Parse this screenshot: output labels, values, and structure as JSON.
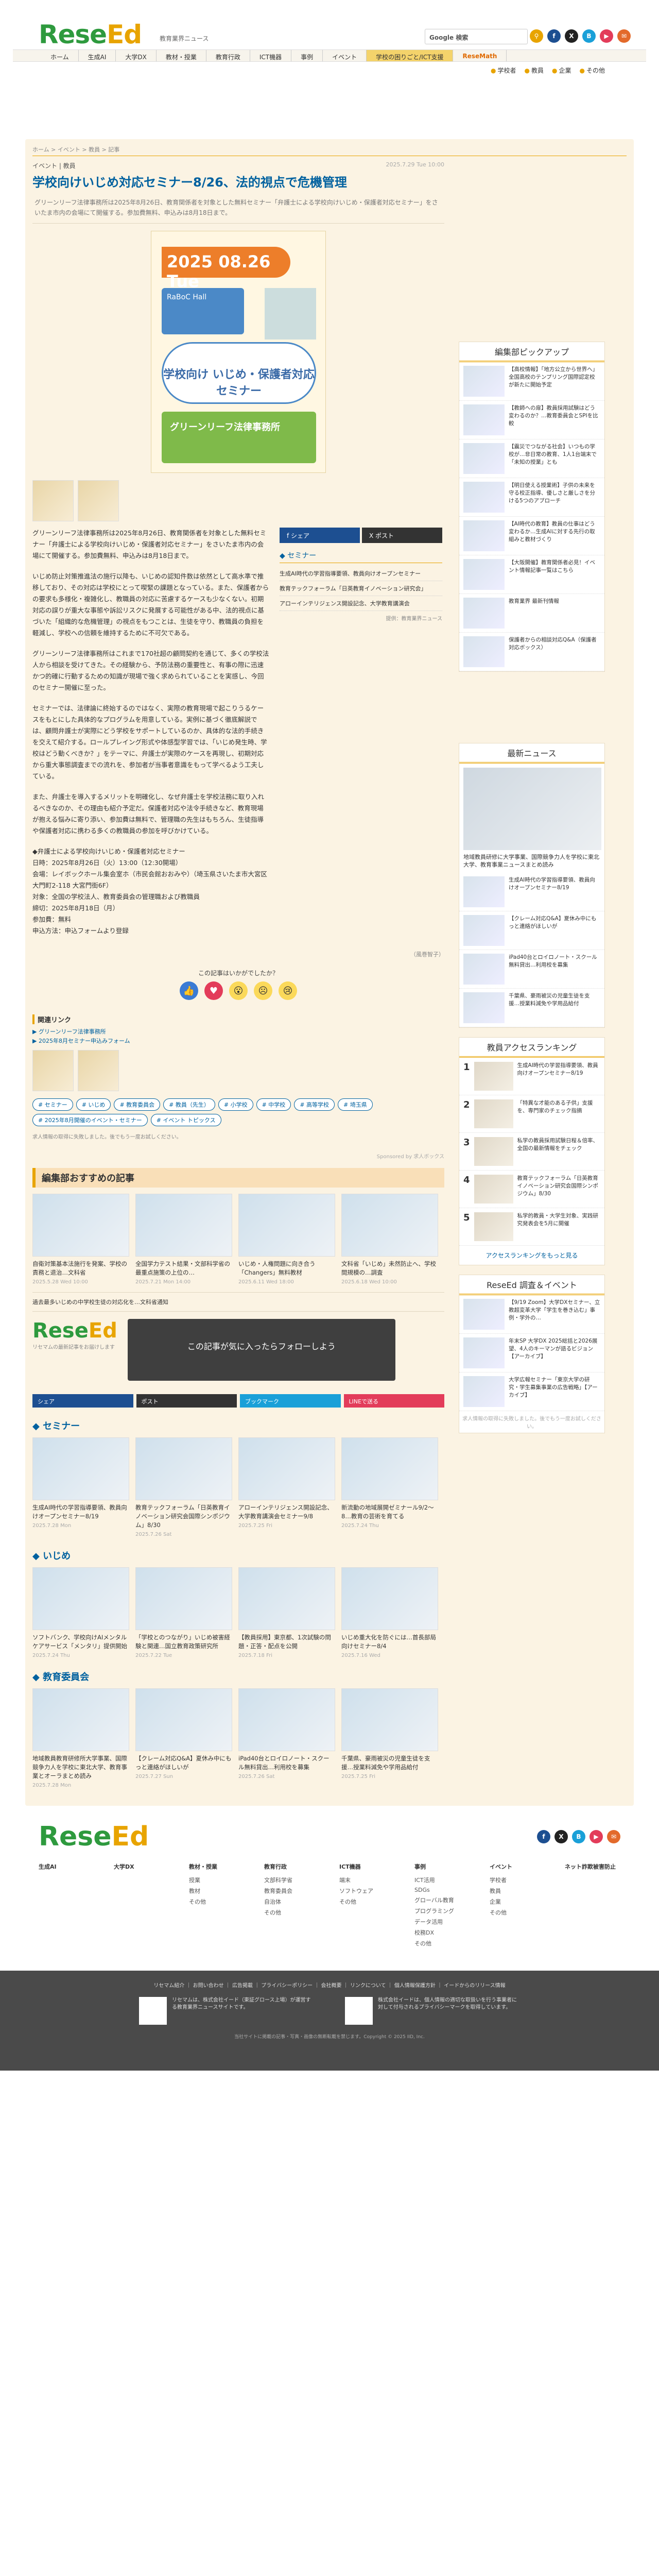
{
  "header": {
    "site_sub": "教育業界ニュース",
    "search_label": "Google 検索",
    "nav": [
      "ホーム",
      "生成AI",
      "大学DX",
      "教材・授業",
      "教育行政",
      "ICT機器",
      "事例",
      "イベント",
      "学校の困りごと/ICT支援",
      "ReseMath"
    ],
    "subnav": [
      "学校者",
      "教員",
      "企業",
      "その他"
    ]
  },
  "breadcrumb": "ホーム > イベント > 教員 > 記事",
  "article": {
    "category": "イベント | 教員",
    "date": "2025.7.29 Tue 10:00",
    "title": "学校向けいじめ対応セミナー8/26、法的視点で危機管理",
    "lead": "グリーンリーフ法律事務所は2025年8月26日、教育関係者を対象とした無料セミナー「弁護士による学校向けいじめ・保護者対応セミナー」をさいたま市内の会場にて開催する。参加費無料、申込みは8月18日まで。",
    "hero": {
      "date": "2025 08.26 Tue",
      "venue": "RaBoC Hall",
      "main": "学校向け いじめ・保護者対応セミナー",
      "org": "グリーンリーフ法律事務所"
    },
    "paragraphs": [
      "グリーンリーフ法律事務所は2025年8月26日、教育関係者を対象とした無料セミナー「弁護士による学校向けいじめ・保護者対応セミナー」をさいたま市内の会場にて開催する。参加費無料、申込みは8月18日まで。",
      "いじめ防止対策推進法の施行以降も、いじめの認知件数は依然として高水準で推移しており、その対応は学校にとって喫緊の課題となっている。また、保護者からの要求も多様化・複雑化し、教職員の対応に苦慮するケースも少なくない。初期対応の誤りが重大な事態や訴訟リスクに発展する可能性がある中、法的視点に基づいた「組織的な危機管理」の視点をもつことは、生徒を守り、教職員の負担を軽減し、学校への信頼を維持するために不可欠である。",
      "グリーンリーフ法律事務所はこれまで170社超の顧問契約を通じて、多くの学校法人から相談を受けてきた。その経験から、予防法務の重要性と、有事の際に迅速かつ的確に行動するための知識が現場で強く求められていることを実感し、今回のセミナー開催に至った。",
      "セミナーでは、法律論に終始するのではなく、実際の教育現場で起こりうるケースをもとにした具体的なプログラムを用意している。実例に基づく徹底解説では、顧問弁護士が実際にどう学校をサポートしているのか、具体的な法的手続きを交えて紹介する。ロールプレイング形式や体感型学習では、「いじめ発生時、学校はどう動くべきか？」をテーマに、弁護士が実際のケースを再現し、初期対応から重大事態調査までの流れを、参加者が当事者意識をもって学べるよう工夫している。",
      "また、弁護士を導入するメリットを明確化し、なぜ弁護士を学校法務に取り入れるべきなのか、その理由も紹介予定だ。保護者対応や法令手続きなど、教育現場が抱える悩みに寄り添い、参加費は無料で、管理職の先生はもちろん、生徒指導や保護者対応に携わる多くの教職員の参加を呼びかけている。",
      "◆弁護士による学校向けいじめ・保護者対応セミナー\n日時：2025年8月26日（火）13:00（12:30開場）\n会場：レイボックホール集会室ホ（市民会館おおみや）（埼玉県さいたま市大宮区大門町2-118 大宮門街6F）\n対象：全国の学校法人、教育委員会の管理職および教職員\n締切：2025年8月18日（月）\n参加費：無料\n申込方法：申込フォームより登録"
    ],
    "writer": "（風巻智子）",
    "reaction_q": "この記事はいかがでしたか？",
    "share_fb": "シェア",
    "share_x": "ポスト",
    "seminar_head": "セミナー",
    "seminar_list": [
      "生成AI時代の学習指導要領、教員向けオープンセミナー",
      "教育テックフォーラム「日英教育イノベーション研究会」",
      "アローインテリジェンス開設記念、大学教育講演会"
    ],
    "seminar_foot": "提供：教育業界ニュース"
  },
  "related": {
    "head": "関連リンク",
    "links": [
      "グリーンリーフ法律事務所",
      "2025年8月セミナー申込みフォーム"
    ]
  },
  "tags": [
    "セミナー",
    "いじめ",
    "教育委員会",
    "教員（先生）",
    "小学校",
    "中学校",
    "高等学校",
    "埼玉県",
    "2025年8月開催のイベント・セミナー",
    "イベント トピックス"
  ],
  "note": "求人情報の取得に失敗しました。後でもう一度お試しください。",
  "sponsored": "Sponsored by 求人ボックス",
  "recommend": {
    "head": "編集部おすすめの記事",
    "cards": [
      {
        "t": "自衛対策基本法施行を発案、学校の責務と退治…文科省",
        "d": "2025.5.28 Wed 10:00"
      },
      {
        "t": "全国学力テスト結果・文部科学省の最重点施策の上位の…",
        "d": "2025.7.21 Mon 14:00"
      },
      {
        "t": "いじめ・人権問題に向き合う「Changers」無料教材",
        "d": "2025.6.11 Wed 18:00"
      },
      {
        "t": "文科省「いじめ」未然防止へ、学校間規模の…調査",
        "d": "2025.6.18 Wed 10:00"
      }
    ],
    "wide": "過去最多いじめの中学校生徒の対応化を…文科省通知"
  },
  "follow": {
    "text": "この記事が気に入ったらフォローしよう",
    "sub": "リセマムの最新記事をお届けします",
    "shares": [
      "シェア",
      "ポスト",
      "ブックマーク",
      "LINEで送る"
    ]
  },
  "categories": [
    {
      "head": "セミナー",
      "cards": [
        {
          "t": "生成AI時代の学習指導要領、教員向けオープンセミナー8/19",
          "d": "2025.7.28 Mon"
        },
        {
          "t": "教育テックフォーラム「日英教育イノベーション研究会国際シンポジウム」8/30",
          "d": "2025.7.26 Sat"
        },
        {
          "t": "アローインテリジェンス開設記念、大学教育講演会セミナー9/8",
          "d": "2025.7.25 Fri"
        },
        {
          "t": "新流動の地域展開ゼミナール9/2～8…教育の芸術を育てる",
          "d": "2025.7.24 Thu"
        }
      ]
    },
    {
      "head": "いじめ",
      "cards": [
        {
          "t": "ソフトバンク、学校向けAIメンタルケアサービス「メンタリ」提供開始",
          "d": "2025.7.24 Thu"
        },
        {
          "t": "「学校とのつながり」いじめ被害経験と関連…国立教育政策研究所",
          "d": "2025.7.22 Tue"
        },
        {
          "t": "【教員採用】東京都、1次試験の問題・正答・配点を公開",
          "d": "2025.7.18 Fri"
        },
        {
          "t": "いじめ重大化を防ぐには…首長部局向けセミナー8/4",
          "d": "2025.7.16 Wed"
        }
      ]
    },
    {
      "head": "教育委員会",
      "cards": [
        {
          "t": "地域教員教育研修所大学事業、国際競争力人を学校に東北大学、教育事業とオーラまとめ読み",
          "d": "2025.7.28 Mon"
        },
        {
          "t": "【クレーム対応Q&A】夏休み中にもっと連絡がほしいが",
          "d": "2025.7.27 Sun"
        },
        {
          "t": "iPad40台とロイロノート・スクール無料貸出…利用校を募集",
          "d": "2025.7.26 Sat"
        },
        {
          "t": "千葉県、豪雨被災の児童生徒を支援…授業料減免や学用品給付",
          "d": "2025.7.25 Fri"
        }
      ]
    }
  ],
  "sidebar": {
    "picks_head": "編集部ピックアップ",
    "picks": [
      "【高校情報】「地方公立から世界へ」全国高校のテンプリング国際認定校が新たに開始予定",
      "【教師への扉】教員採用試験はどう変わるのか？…教育委員会とSPIを比較",
      "【震災でつながる社会】いつもの学校が…非日常の教育、1人1台端末で「未知の授業」とも",
      "【明日使える授業術】子供の未来を守る校正指導、優しさと厳しさを分ける5つのアプローチ",
      "【AI時代の教育】教員の仕事はどう変わるか…生成AIに対する先行の取組みと教材づくり",
      "【大阪開催】教育関係者必見！イベント情報記事一覧はこちら",
      "教育業界 最新刊情報",
      "保護者からの相談対応Q&A（保護者対応ボックス）"
    ],
    "news_head": "最新ニュース",
    "news_main": "地域教員研修に大学事業、国際競争力人を学校に東北大学、教育事業ニュースまとめ読み",
    "news": [
      "生成AI時代の学習指導要領、教員向けオープンセミナー8/19",
      "【クレーム対応Q&A】夏休み中にもっと連絡がほしいが",
      "iPad40台とロイロノート・スクール無料貸出…利用校を募集",
      "千葉県、豪雨被災の児童生徒を支援…授業料減免や学用品給付"
    ],
    "ranking_head": "教員アクセスランキング",
    "ranking": [
      "生成AI時代の学習指導要領、教員向けオープンセミナー8/19",
      "「特異な才能のある子供」支援を、専門家のチェック指摘",
      "私学の教員採用試験日程＆倍率、全国の最新情報をチェック",
      "教育テックフォーラム「日英教育イノベーション研究会国際シンポジウム」8/30",
      "私学的教員・大学生対象、実践研究発表会を5月に開催"
    ],
    "ranking_more": "アクセスランキングをもっと見る",
    "events_head": "ReseEd 調査＆イベント",
    "events": [
      "【9/19 Zoom】大学DXセミナー、立教超変革大学「学生を巻き込む」事例・学外の…",
      "年末SP 大学DX 2025総括と2026展望、4人のキーマンが語るビジョン【アーカイブ】",
      "大学広報セミナー「東京大学の研究・学生募集事業の広告戦略」【アーカイブ】"
    ],
    "jobs_note": "求人情報の取得に失敗しました。後でもう一度お試しください。"
  },
  "footer": {
    "cols": [
      {
        "h": "生成AI",
        "items": []
      },
      {
        "h": "大学DX",
        "items": []
      },
      {
        "h": "教材・授業",
        "items": [
          "授業",
          "教材",
          "その他"
        ]
      },
      {
        "h": "教育行政",
        "items": [
          "文部科学省",
          "教育委員会",
          "自治体",
          "その他"
        ]
      },
      {
        "h": "ICT機器",
        "items": [
          "端末",
          "ソフトウェア",
          "その他"
        ]
      },
      {
        "h": "事例",
        "items": [
          "ICT活用",
          "SDGs",
          "グローバル教育",
          "プログラミング",
          "データ活用",
          "校務DX",
          "その他"
        ]
      },
      {
        "h": "イベント",
        "items": [
          "学校者",
          "教員",
          "企業",
          "その他"
        ]
      },
      {
        "h": "ネット詐欺被害防止",
        "items": []
      }
    ],
    "links": "リセマム紹介 ｜ お問い合わせ ｜ 広告掲載 ｜ プライバシーポリシー ｜ 会社概要 ｜ リンクについて ｜ 個人情報保護方針 ｜ イードからのリリース情報",
    "co1": "リセマムは、株式会社イード（東証グロース上場）が運営する教育業界ニュースサイトです。",
    "co2": "株式会社イードは、個人情報の適切な取扱いを行う事業者に対して付与されるプライバシーマークを取得しています。",
    "copyright": "当社サイトに掲載の記事・写真・画像の無断転載を禁じます。Copyright © 2025 IID, Inc."
  },
  "colors": {
    "brand_green": "#2e9a3e",
    "brand_orange": "#e8a400",
    "link_blue": "#00619f"
  }
}
